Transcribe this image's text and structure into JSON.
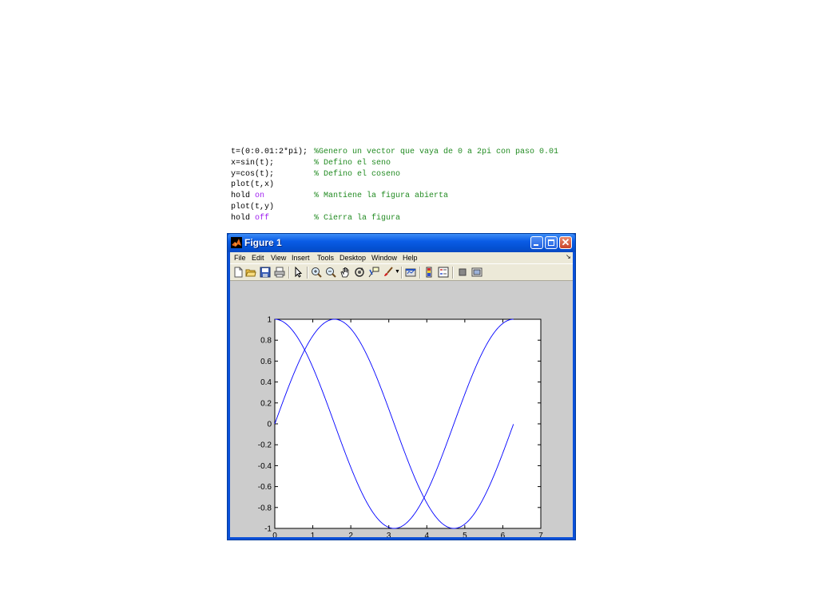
{
  "code": {
    "lines": [
      {
        "stmt": "t=(0:0.01:2*pi);",
        "comment": "%Genero un vector que vaya de 0 a 2pi con paso 0.01"
      },
      {
        "stmt": "x=sin(t);",
        "comment": "% Defino el seno"
      },
      {
        "stmt": "y=cos(t);",
        "comment": "% Defino el coseno"
      },
      {
        "stmt": "plot(t,x)",
        "comment": ""
      },
      {
        "stmt": "hold ",
        "keyword": "on",
        "comment": "% Mantiene la figura abierta"
      },
      {
        "stmt": "plot(t,y)",
        "comment": ""
      },
      {
        "stmt": "hold ",
        "keyword": "off",
        "comment": "% Cierra la figura"
      }
    ],
    "comment_color": "#228b22",
    "keyword_color": "#a020f0"
  },
  "window": {
    "title": "Figure 1",
    "close_glyph": "✕",
    "menu": [
      "File",
      "Edit",
      "View",
      "Insert",
      "Tools",
      "Desktop",
      "Window",
      "Help"
    ],
    "menu_arrow": "↘",
    "toolbar_icons": [
      "new-figure-icon",
      "open-file-icon",
      "save-icon",
      "print-icon",
      "edit-plot-arrow-icon",
      "zoom-in-icon",
      "zoom-out-icon",
      "pan-hand-icon",
      "rotate-3d-icon",
      "data-cursor-icon",
      "brush-icon",
      "link-plot-icon",
      "colorbar-icon",
      "legend-icon",
      "hide-plot-tools-icon",
      "show-plot-tools-icon"
    ]
  },
  "chart_data": {
    "type": "line",
    "series": [
      {
        "function": "sin",
        "x_range": [
          0,
          6.28
        ],
        "step": 0.01,
        "color": "#0000ff"
      },
      {
        "function": "cos",
        "x_range": [
          0,
          6.28
        ],
        "step": 0.01,
        "color": "#0000ff"
      }
    ],
    "xlim": [
      0,
      7
    ],
    "ylim": [
      -1,
      1
    ],
    "xticks": [
      "0",
      "1",
      "2",
      "3",
      "4",
      "5",
      "6",
      "7"
    ],
    "yticks": [
      "-1",
      "-0.8",
      "-0.6",
      "-0.4",
      "-0.2",
      "0",
      "0.2",
      "0.4",
      "0.6",
      "0.8",
      "1"
    ],
    "title": "",
    "xlabel": "",
    "ylabel": "",
    "grid": false,
    "legend": "none"
  }
}
